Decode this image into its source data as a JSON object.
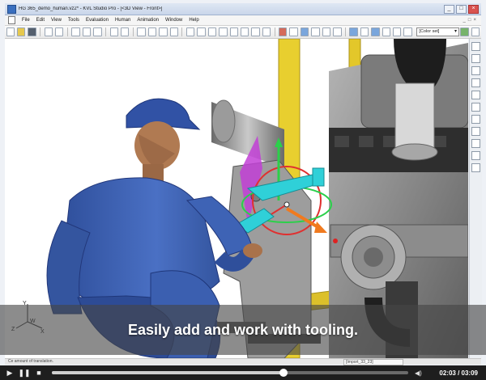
{
  "window": {
    "title": "HG 365_demo_human.vz2* - KVL Studio Pro - [<3D View - Front>]",
    "controls": [
      "_",
      "□",
      "×"
    ]
  },
  "menu": {
    "items": [
      "File",
      "Edit",
      "View",
      "Tools",
      "Evaluation",
      "Human",
      "Animation",
      "Window",
      "Help"
    ],
    "mdi_controls": [
      "_",
      "□",
      "×"
    ]
  },
  "toolbar": {
    "color_set_value": "[Color set]"
  },
  "axis": {
    "y": "Y",
    "w": "W",
    "z": "Z",
    "x": "X"
  },
  "caption": {
    "text": "Easily add and work with tooling."
  },
  "status": {
    "left": "Ce amount of translation.",
    "middle": "[Import_33_23]"
  },
  "player": {
    "current_time": "02:03",
    "duration": "03:09",
    "progress": 0.65,
    "icons": [
      "play-icon",
      "pause-icon",
      "stop-icon",
      "volume-icon"
    ]
  },
  "colors": {
    "caption_band": "#464646",
    "player_bg": "#1e1e1e",
    "human_shirt": "#3b5fb0",
    "scaffold_yellow": "#e8cf2f",
    "tool_cyan": "#2fd0d8",
    "engine_gray": "#8a8a8a"
  }
}
